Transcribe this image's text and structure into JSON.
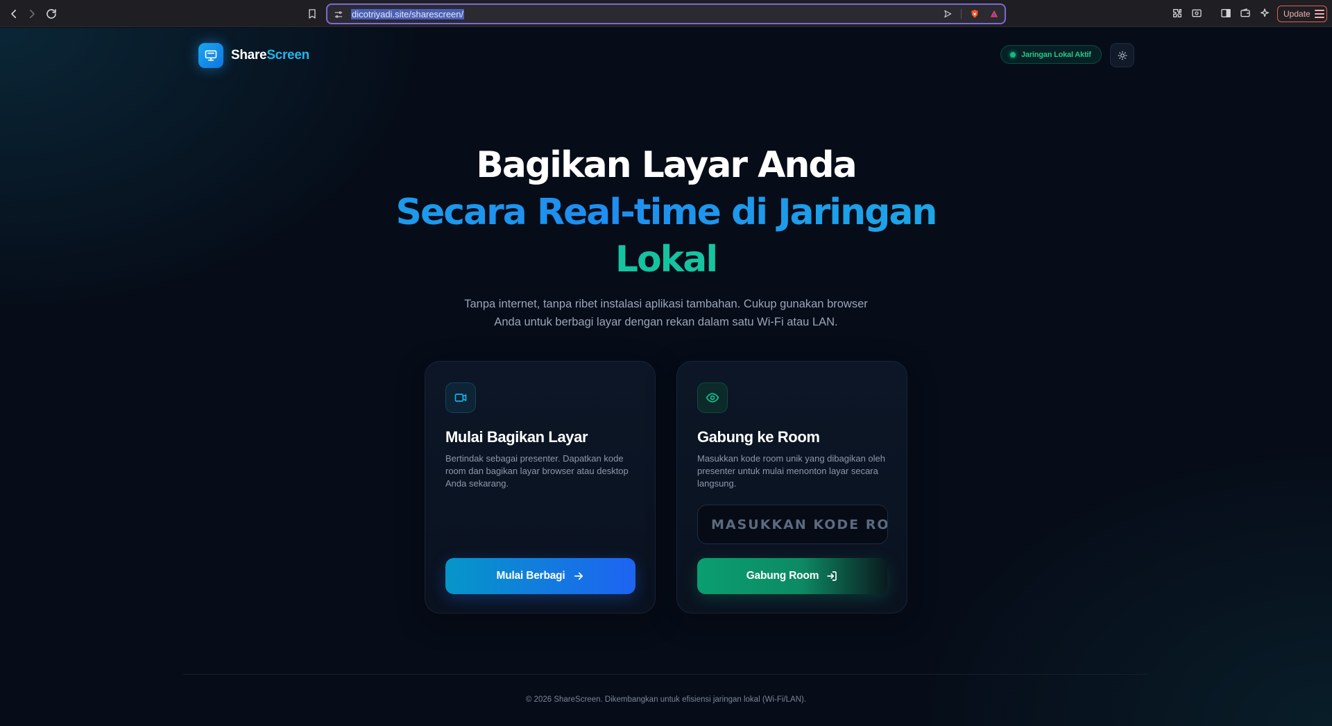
{
  "browser": {
    "url": "dicotriyadi.site/sharescreen/",
    "update_label": "Update"
  },
  "brand": {
    "name_part1": "Share",
    "name_part2": "Screen"
  },
  "header": {
    "status_label": "Jaringan Lokal Aktif"
  },
  "hero": {
    "line1": "Bagikan Layar Anda",
    "line2": "Secara Real-time di Jaringan",
    "line3": "Lokal",
    "subtitle_line1": "Tanpa internet, tanpa ribet instalasi aplikasi tambahan. Cukup gunakan browser",
    "subtitle_line2": "Anda untuk berbagi layar dengan rekan dalam satu Wi-Fi atau LAN."
  },
  "cards": [
    {
      "title": "Mulai Bagikan Layar",
      "description": "Bertindak sebagai presenter. Dapatkan kode room dan bagikan layar browser atau desktop Anda sekarang.",
      "button_label": "Mulai Berbagi",
      "icon": "video-camera-icon"
    },
    {
      "title": "Gabung ke Room",
      "description": "Masukkan kode room unik yang dibagikan oleh presenter untuk mulai menonton layar secara langsung.",
      "input_placeholder": "MASUKKAN KODE ROOM",
      "button_label": "Gabung Room",
      "icon": "eye-icon"
    }
  ],
  "footer": {
    "text": "© 2026 ShareScreen. Dikembangkan untuk efisiensi jaringan lokal (Wi-Fi/LAN)."
  },
  "colors": {
    "accent_blue": "#1e8ef0",
    "accent_green": "#10b981",
    "background": "#060c18"
  }
}
